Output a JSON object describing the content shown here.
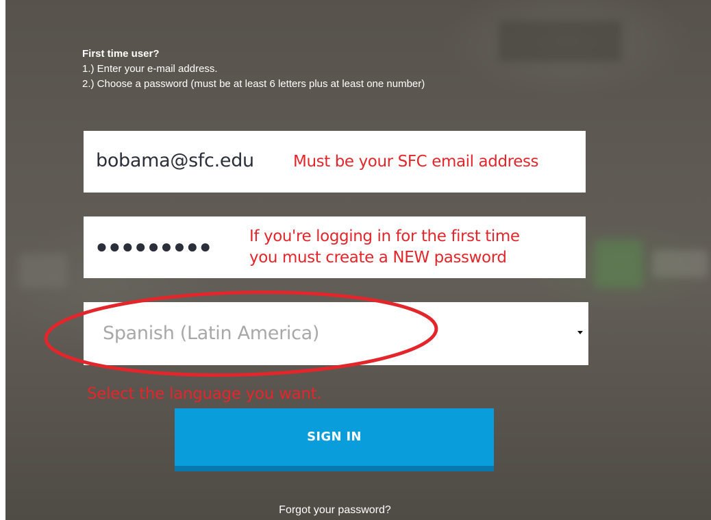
{
  "intro": {
    "heading": "First time user?",
    "step1": "1.) Enter your e-mail address.",
    "step2": "2.) Choose a password (must be at least 6 letters plus at least one number)"
  },
  "email": {
    "value": "bobama@sfc.edu",
    "annotation": "Must be your SFC email address"
  },
  "password": {
    "masked_value": "●●●●●●●●●",
    "annotation_line1": "If you're logging in for the first time",
    "annotation_line2": "you must create a NEW password"
  },
  "language": {
    "selected": "Spanish (Latin America)",
    "annotation": "Select the language you want."
  },
  "signin": {
    "label": "SIGN IN"
  },
  "forgot": {
    "label": "Forgot your password?"
  },
  "colors": {
    "annotation_red": "#e3262b",
    "button_blue": "#0a9ddc",
    "button_shadow": "#0778b0",
    "overlay": "#5e5a53"
  }
}
